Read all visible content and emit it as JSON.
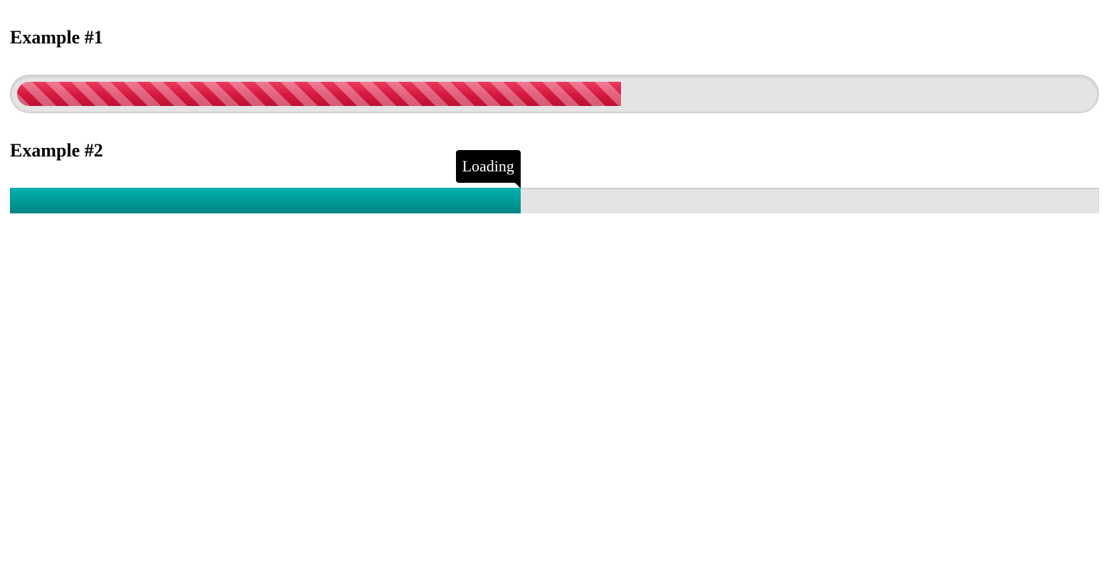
{
  "examples": [
    {
      "title": "Example #1",
      "progress_percent": 56.2,
      "style": "rounded-striped",
      "fill_color": "#d4173e"
    },
    {
      "title": "Example #2",
      "progress_percent": 46.9,
      "style": "flat",
      "fill_color": "#009895",
      "tooltip": "Loading"
    }
  ],
  "colors": {
    "track": "#e4e4e4",
    "tooltip_bg": "#000000",
    "tooltip_text": "#ffffff"
  }
}
